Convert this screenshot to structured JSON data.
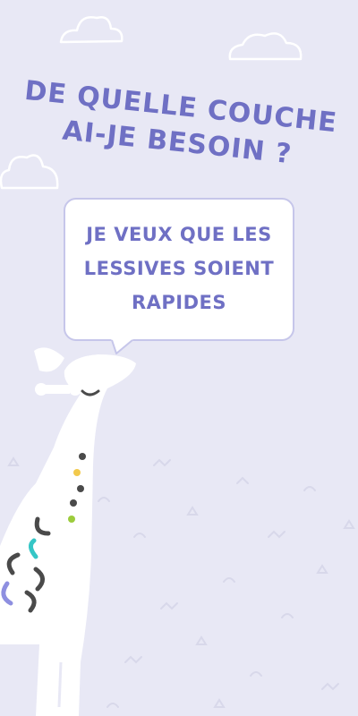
{
  "heading": {
    "line1": "DE QUELLE COUCHE",
    "line2": "AI-JE BESOIN ?"
  },
  "speech_bubble": {
    "line1": "JE VEUX QUE LES",
    "line2": "LESSIVES SOIENT",
    "line3": "RAPIDES"
  },
  "colors": {
    "background": "#e8e8f5",
    "accent": "#6f70c4",
    "bubble_border": "#c6c6ea",
    "spot_yellow": "#f2c94c",
    "spot_green": "#9ccc3c",
    "spot_teal": "#35c6c6",
    "spot_purple": "#8e8fe0",
    "spot_dark": "#4a4a4a"
  }
}
